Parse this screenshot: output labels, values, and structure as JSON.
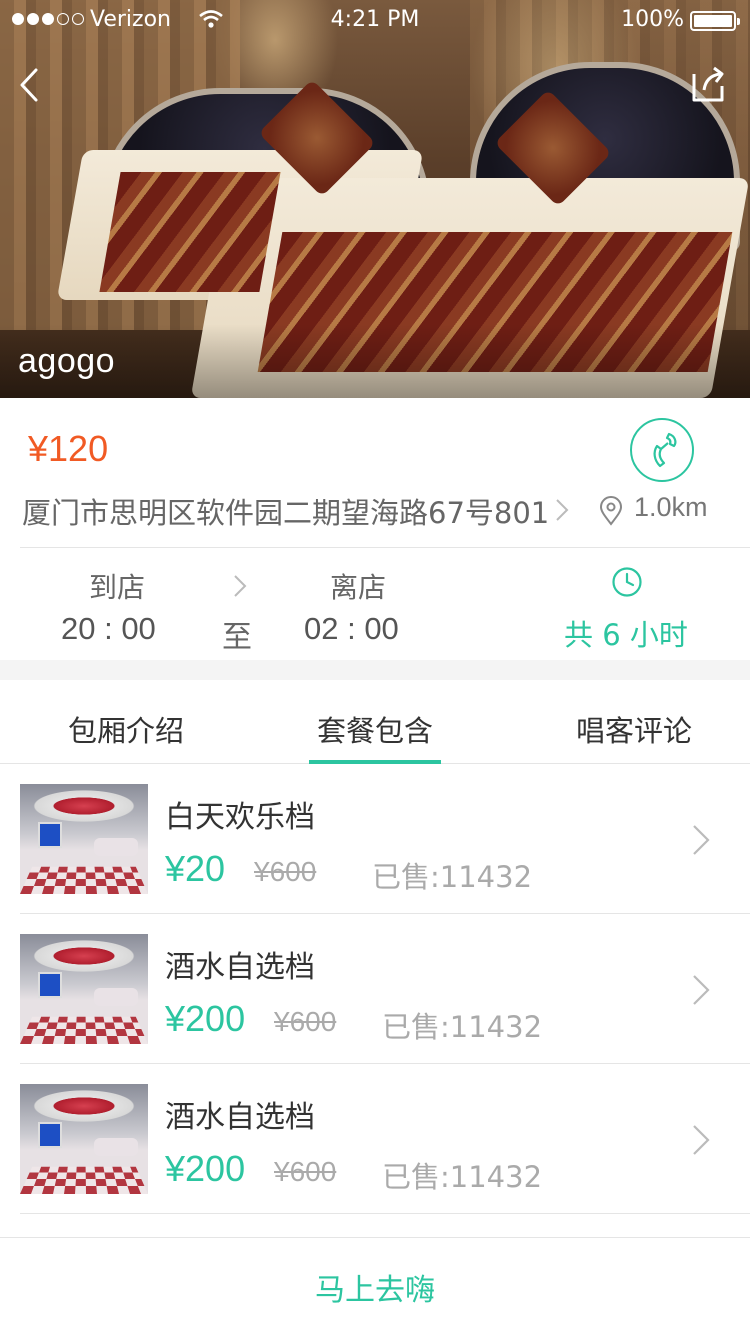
{
  "status_bar": {
    "carrier": "Verizon",
    "time": "4:21 PM",
    "battery": "100%"
  },
  "hero": {
    "venue_name": "agogo"
  },
  "info": {
    "price": "¥120",
    "address": "厦门市思明区软件园二期望海路67号801",
    "distance": "1.0km"
  },
  "time_info": {
    "arrive_label": "到店",
    "arrive_time": "20 : 00",
    "to_label": "至",
    "leave_label": "离店",
    "leave_time": "02 : 00",
    "total": "共 6 小时"
  },
  "tabs": [
    {
      "label": "包厢介绍"
    },
    {
      "label": "套餐包含",
      "active": true
    },
    {
      "label": "唱客评论"
    }
  ],
  "packages": [
    {
      "title": "白天欢乐档",
      "price": "¥20",
      "original": "¥600",
      "sold": "已售:11432"
    },
    {
      "title": "酒水自选档",
      "price": "¥200",
      "original": "¥600",
      "sold": "已售:11432"
    },
    {
      "title": "酒水自选档",
      "price": "¥200",
      "original": "¥600",
      "sold": "已售:11432"
    }
  ],
  "bottom": {
    "go_label": "马上去嗨"
  },
  "colors": {
    "accent": "#2cc5a0",
    "price_orange": "#f15a24"
  },
  "icons": [
    "back-arrow-icon",
    "share-icon",
    "phone-icon",
    "location-pin-icon",
    "clock-icon",
    "chevron-right-icon",
    "wifi-icon",
    "battery-icon"
  ]
}
